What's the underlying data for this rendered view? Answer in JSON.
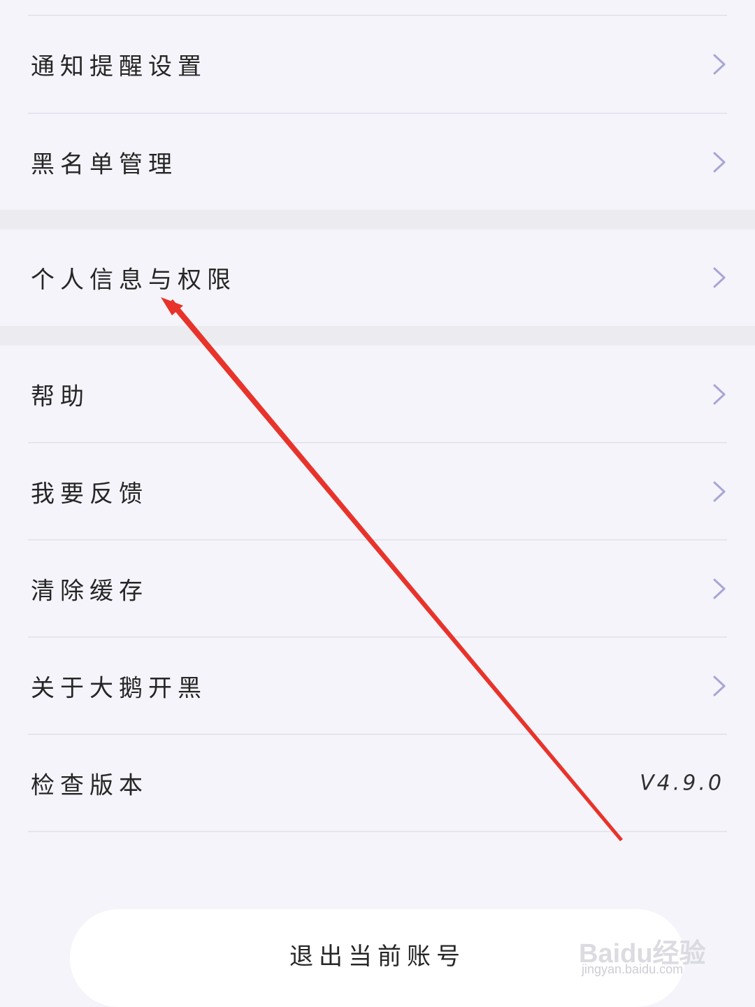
{
  "settings": {
    "group1": [
      {
        "label": "通知提醒设置",
        "chevron_icon": "chevron-right-icon"
      },
      {
        "label": "黑名单管理",
        "chevron_icon": "chevron-right-icon"
      }
    ],
    "group2": [
      {
        "label": "个人信息与权限",
        "chevron_icon": "chevron-right-icon"
      }
    ],
    "group3": [
      {
        "label": "帮助",
        "chevron_icon": "chevron-right-icon"
      },
      {
        "label": "我要反馈",
        "chevron_icon": "chevron-right-icon"
      },
      {
        "label": "清除缓存",
        "chevron_icon": "chevron-right-icon"
      },
      {
        "label": "关于大鹅开黑",
        "chevron_icon": "chevron-right-icon"
      },
      {
        "label": "检查版本",
        "value": "V4.9.0"
      }
    ]
  },
  "logout": {
    "label": "退出当前账号"
  },
  "watermark": {
    "brand": "Baidu经验",
    "url": "jingyan.baidu.com"
  },
  "colors": {
    "background": "#f5f4fb",
    "section_gap": "#ececf0",
    "chevron": "#a8a6d6",
    "annotation_arrow": "#e8332a",
    "logout_bg": "#ffffff"
  }
}
